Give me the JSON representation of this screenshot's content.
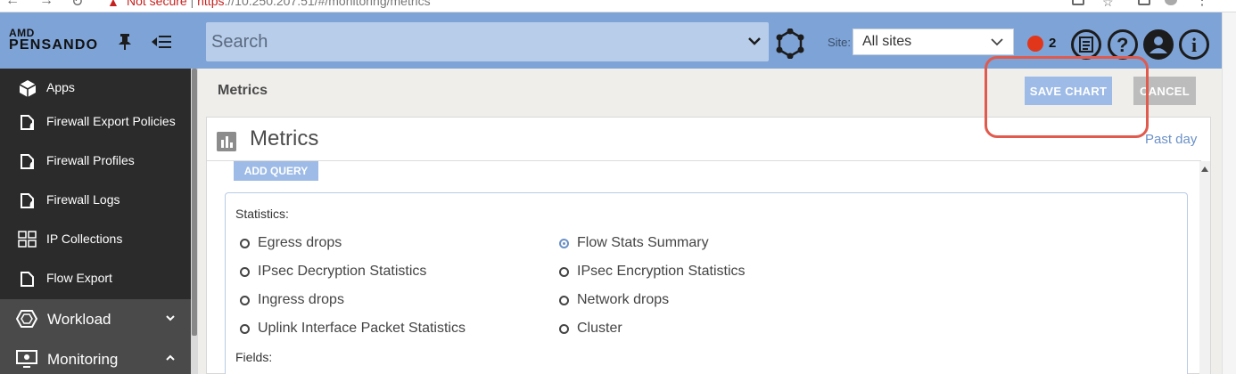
{
  "browser": {
    "security_warning": "Not secure",
    "url_scheme": "https",
    "url_rest": "://10.250.207.51/#/monitoring/metrics"
  },
  "header": {
    "brand_top": "AMD",
    "brand_name": "PENSANDO",
    "search_placeholder": "Search",
    "site_label": "Site:",
    "site_value": "All sites",
    "alert_count": "2",
    "accent_color": "#7ea3d6"
  },
  "sidebar": {
    "items": [
      {
        "label": "Apps",
        "icon": "cube-icon"
      },
      {
        "label": "Firewall Export Policies",
        "icon": "firewall-policy-icon"
      },
      {
        "label": "Firewall Profiles",
        "icon": "firewall-profile-icon"
      },
      {
        "label": "Firewall Logs",
        "icon": "firewall-logs-icon"
      },
      {
        "label": "IP Collections",
        "icon": "ip-collections-icon"
      },
      {
        "label": "Flow Export",
        "icon": "flow-export-icon"
      }
    ],
    "groups": [
      {
        "label": "Workload",
        "icon": "workload-icon",
        "state": "collapsed"
      },
      {
        "label": "Monitoring",
        "icon": "monitoring-icon",
        "state": "expanded"
      }
    ]
  },
  "main": {
    "page_title": "Metrics",
    "save_chart_label": "SAVE CHART",
    "cancel_label": "CANCEL",
    "card_title": "Metrics",
    "time_range": "Past day",
    "add_query_label": "ADD QUERY",
    "statistics_label": "Statistics:",
    "fields_label": "Fields:",
    "statistics": [
      {
        "label": "Egress drops",
        "checked": false
      },
      {
        "label": "Flow Stats Summary",
        "checked": true
      },
      {
        "label": "IPsec Decryption Statistics",
        "checked": false
      },
      {
        "label": "IPsec Encryption Statistics",
        "checked": false
      },
      {
        "label": "Ingress drops",
        "checked": false
      },
      {
        "label": "Network drops",
        "checked": false
      },
      {
        "label": "Uplink Interface Packet Statistics",
        "checked": false
      },
      {
        "label": "Cluster",
        "checked": false
      }
    ],
    "highlight_color": "#e05a4e"
  }
}
